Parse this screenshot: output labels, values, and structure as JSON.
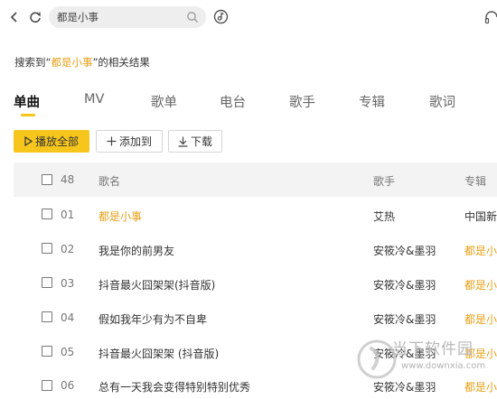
{
  "search": {
    "value": "都是小事",
    "placeholder": "都是小事"
  },
  "summary": {
    "prefix": "搜索到“",
    "keyword": "都是小事",
    "suffix": "”的相关结果"
  },
  "tabs": [
    {
      "label": "单曲",
      "active": true
    },
    {
      "label": "MV",
      "active": false
    },
    {
      "label": "歌单",
      "active": false
    },
    {
      "label": "电台",
      "active": false
    },
    {
      "label": "歌手",
      "active": false
    },
    {
      "label": "专辑",
      "active": false
    },
    {
      "label": "歌词",
      "active": false
    }
  ],
  "actions": {
    "play_all": "播放全部",
    "add_to": "添加到",
    "download": "下载"
  },
  "table": {
    "headers": {
      "count": "48",
      "song": "歌名",
      "singer": "歌手",
      "album": "专辑"
    },
    "rows": [
      {
        "num": "01",
        "song": "都是小事",
        "singer": "艾热",
        "album": "中国新"
      },
      {
        "num": "02",
        "song": "我是你的前男友",
        "singer": "安筱冷&墨羽",
        "album": "都是小"
      },
      {
        "num": "03",
        "song": "抖音最火囧架架(抖音版)",
        "singer": "安筱冷&墨羽",
        "album": "都是小"
      },
      {
        "num": "04",
        "song": "假如我年少有为不自卑",
        "singer": "安筱冷&墨羽",
        "album": "都是小"
      },
      {
        "num": "05",
        "song": "抖音最火囧架架 (抖音版)",
        "singer": "安筱冷&墨羽",
        "album": "都是小"
      },
      {
        "num": "06",
        "song": "总有一天我会变得特别特别优秀",
        "singer": "安筱冷&墨羽",
        "album": "都是小"
      }
    ]
  },
  "watermark": {
    "name": "当下软件园",
    "url": "www.downxia.com"
  },
  "colors": {
    "accent": "#f7c61d",
    "highlight": "#e7a11a",
    "header_bg": "#f3f3f3"
  },
  "icons": [
    "back-arrow-icon",
    "refresh-icon",
    "search-icon",
    "music-recognition-icon",
    "headset-icon",
    "play-icon",
    "plus-icon",
    "download-icon"
  ]
}
